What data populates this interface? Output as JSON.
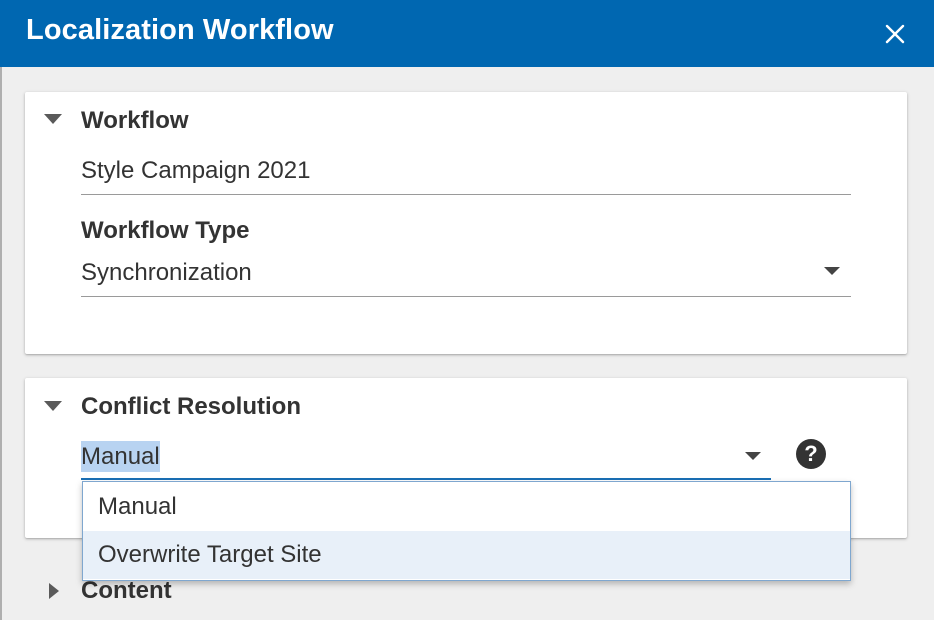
{
  "dialog": {
    "title": "Localization Workflow",
    "close_icon": "close-icon"
  },
  "workflow_section": {
    "title": "Workflow",
    "name_value": "Style Campaign 2021",
    "type_label": "Workflow Type",
    "type_value": "Synchronization"
  },
  "conflict_section": {
    "title": "Conflict Resolution",
    "selected_value": "Manual",
    "help_icon": "question-circle-icon",
    "options": [
      "Manual",
      "Overwrite Target Site"
    ],
    "hovered_option": "Overwrite Target Site"
  },
  "content_section": {
    "title": "Content"
  },
  "colors": {
    "header": "#0067b1",
    "selection_highlight": "#b8d3f1",
    "option_hover": "#e8f0f9",
    "active_underline": "#1a6fb5"
  }
}
